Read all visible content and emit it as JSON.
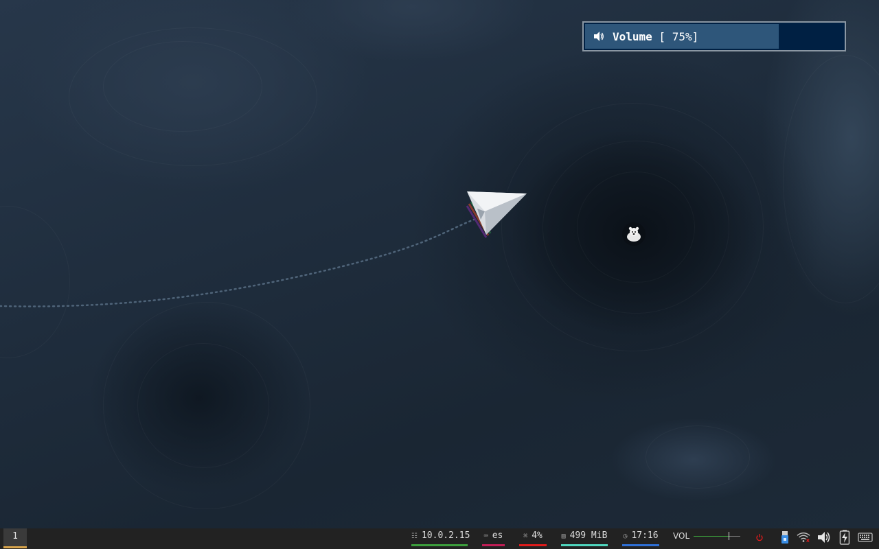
{
  "osd": {
    "icon": "speaker-icon",
    "title": "Volume",
    "value_text": " [ 75%]",
    "level": 0.75,
    "fill_color": "#2e567a",
    "track_color": "#002043"
  },
  "desktop": {
    "wallpaper": "paper-plane-topographic",
    "plane_icon": "paper-plane-icon",
    "desktop_icon": "bear-sticker-icon"
  },
  "taskbar": {
    "workspace": "1",
    "network": {
      "icon": "network-icon",
      "value": "10.0.2.15",
      "color": "#3da03d"
    },
    "keyboard": {
      "icon": "keyboard-icon",
      "value": "es",
      "color": "#c21e56"
    },
    "cpu": {
      "icon": "cpu-icon",
      "value": "4%",
      "color": "#e01b1b"
    },
    "memory": {
      "icon": "memory-icon",
      "value": "499 MiB",
      "color": "#4fd6be"
    },
    "clock": {
      "icon": "clock-icon",
      "value": "17:16",
      "color": "#2e6fd6"
    },
    "volume": {
      "label": "VOL",
      "level": 0.75
    },
    "tray": [
      "power-icon",
      "usb-drive-icon",
      "wifi-icon",
      "speaker-icon",
      "battery-charging-icon",
      "keyboard-tray-icon"
    ]
  }
}
